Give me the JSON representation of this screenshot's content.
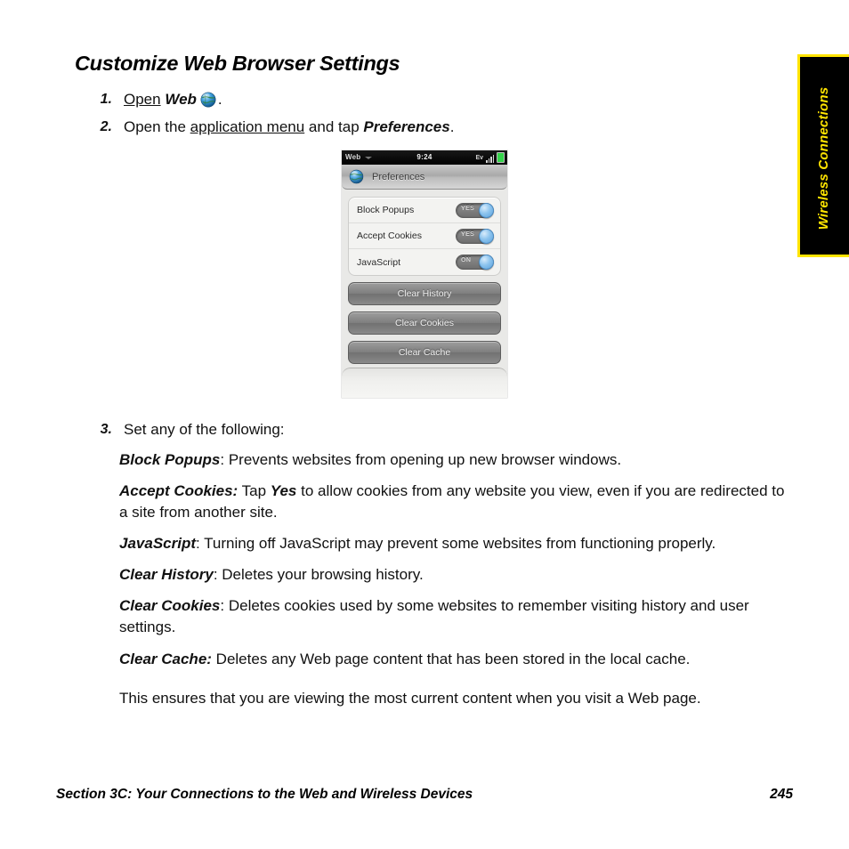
{
  "page": {
    "heading": "Customize Web Browser Settings",
    "background_color": "#ffffff"
  },
  "steps": [
    {
      "num": "1.",
      "parts": [
        {
          "text": "Open",
          "style": "underline"
        },
        {
          "text": " ",
          "style": "plain"
        },
        {
          "text": "Web",
          "style": "bold-italic"
        },
        {
          "text": " ",
          "style": "plain"
        },
        {
          "text": "globe-icon",
          "style": "icon"
        },
        {
          "text": ".",
          "style": "plain"
        }
      ]
    },
    {
      "num": "2.",
      "parts": [
        {
          "text": "Open the ",
          "style": "plain"
        },
        {
          "text": "application menu",
          "style": "underline"
        },
        {
          "text": " and tap ",
          "style": "plain"
        },
        {
          "text": "Preferences",
          "style": "bold-italic"
        },
        {
          "text": ".",
          "style": "plain"
        }
      ]
    },
    {
      "num": "3.",
      "parts": [
        {
          "text": "Set any of the following:",
          "style": "plain"
        }
      ]
    }
  ],
  "step1": {
    "open_label": "Open",
    "web_label": "Web",
    "period": "."
  },
  "step2": {
    "prefix": "Open the ",
    "link": "application menu",
    "middle": " and tap ",
    "emphasis": "Preferences",
    "suffix": "."
  },
  "step3": {
    "text": "Set any of the following:"
  },
  "phone": {
    "statusbar": {
      "app_name": "Web",
      "time": "9:24",
      "ev_indicator": "Ev",
      "signal_icon": "signal-bars-icon",
      "battery_icon": "battery-icon",
      "dropdown_icon": "chevron-down-icon"
    },
    "header": {
      "icon": "globe-icon",
      "title": "Preferences"
    },
    "preferences": [
      {
        "label": "Block Popups",
        "toggle_text": "YES",
        "state": "on"
      },
      {
        "label": "Accept Cookies",
        "toggle_text": "YES",
        "state": "on"
      },
      {
        "label": "JavaScript",
        "toggle_text": "ON",
        "state": "on"
      }
    ],
    "buttons": [
      {
        "label": "Clear History"
      },
      {
        "label": "Clear Cookies"
      },
      {
        "label": "Clear Cache"
      }
    ]
  },
  "descriptions": [
    {
      "term": "Block Popups",
      "sep": ": ",
      "text": "Prevents websites from opening up new browser windows."
    },
    {
      "term": "Accept Cookies:",
      "sep": " ",
      "text": "Tap ",
      "emph": "Yes",
      "text2": " to allow cookies from any website you view, even if you are redirected to a site from another site."
    },
    {
      "term": "JavaScript",
      "sep": ": ",
      "text": "Turning off JavaScript may prevent some websites from functioning properly."
    },
    {
      "term": "Clear History",
      "sep": ": ",
      "text": "Deletes your browsing history."
    },
    {
      "term": "Clear Cookies",
      "sep": ": ",
      "text": "Deletes cookies used by some websites to remember visiting history and user settings."
    },
    {
      "term": "Clear Cache:",
      "sep": " ",
      "text": "Deletes any Web page content that has been stored in the local cache."
    }
  ],
  "closing_note": "This ensures that you are viewing the most current content when you visit a Web page.",
  "side_tab": {
    "label": "Wireless Connections",
    "background_color": "#000000",
    "text_color": "#ffe400"
  },
  "footer": {
    "section": "Section 3C: Your Connections to the Web and Wireless Devices",
    "page_number": "245"
  }
}
